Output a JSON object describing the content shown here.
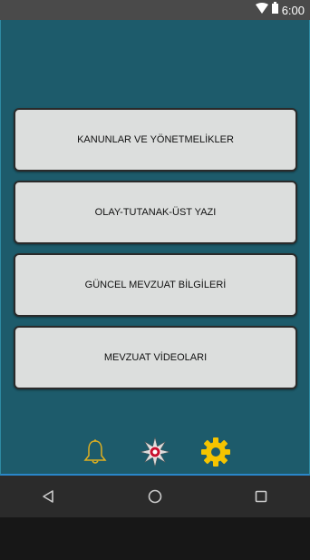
{
  "status_bar": {
    "time": "6:00"
  },
  "menu": {
    "items": [
      {
        "label": "KANUNLAR VE YÖNETMELİKLER"
      },
      {
        "label": "OLAY-TUTANAK-ÜST YAZI"
      },
      {
        "label": "GÜNCEL MEVZUAT BİLGİLERİ"
      },
      {
        "label": "MEVZUAT VİDEOLARI"
      }
    ]
  },
  "bottom_icons": [
    "bell-icon",
    "emblem-icon",
    "gear-icon"
  ],
  "nav_bar": [
    "back-icon",
    "home-icon",
    "recents-icon"
  ],
  "colors": {
    "app_background": "#1d5b6b",
    "button_background": "#dcdedd",
    "gear": "#f5c400",
    "bell": "#e0b020"
  }
}
